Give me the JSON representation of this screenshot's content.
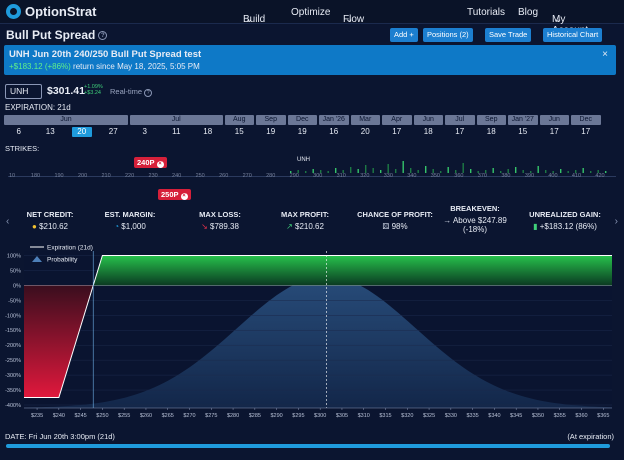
{
  "nav": {
    "logo": "OptionStrat",
    "items": [
      {
        "label": "Build",
        "caret": true
      },
      {
        "label": "Optimize",
        "caret": false
      },
      {
        "label": "Flow",
        "caret": true
      },
      {
        "label": "Tutorials",
        "caret": false
      },
      {
        "label": "Blog",
        "caret": false
      },
      {
        "label": "My Account",
        "caret": true
      }
    ]
  },
  "strategy": {
    "title": "Bull Put Spread"
  },
  "toolbar": {
    "add_label": "Add +",
    "positions_label": "Positions (2)",
    "save_label": "Save Trade",
    "historical_label": "Historical Chart"
  },
  "banner": {
    "title": "UNH Jun 20th 240/250 Bull Put Spread test",
    "gain": "+$183.12 (+86%)",
    "since": " return since May 18, 2025, 5:05 PM",
    "close": "×"
  },
  "quote": {
    "symbol": "UNH",
    "price": "$301.41",
    "change_pct": "+1.09%",
    "change_abs": "+$3.24",
    "realtime": "Real-time"
  },
  "expiration": {
    "label": "EXPIRATION: 21d",
    "months": [
      {
        "label": "Jun",
        "days": [
          "6",
          "13",
          "20",
          "27"
        ]
      },
      {
        "label": "Jul",
        "days": [
          "3",
          "11",
          "18"
        ]
      },
      {
        "label": "Aug",
        "days": [
          "15"
        ]
      },
      {
        "label": "Sep",
        "days": [
          "19"
        ]
      },
      {
        "label": "Dec",
        "days": [
          "19"
        ]
      },
      {
        "label": "Jan '26",
        "days": [
          "16"
        ]
      },
      {
        "label": "Mar",
        "days": [
          "20"
        ]
      },
      {
        "label": "Apr",
        "days": [
          "17"
        ]
      },
      {
        "label": "Jun",
        "days": [
          "18"
        ]
      },
      {
        "label": "Jul",
        "days": [
          "17"
        ]
      },
      {
        "label": "Sep",
        "days": [
          "18"
        ]
      },
      {
        "label": "Jan '27",
        "days": [
          "15"
        ]
      },
      {
        "label": "Jun",
        "days": [
          "17"
        ]
      },
      {
        "label": "Dec",
        "days": [
          "17"
        ]
      }
    ],
    "selected_day": "20"
  },
  "strikes": {
    "label": "STRIKES:",
    "ticks": [
      "10",
      "180",
      "190",
      "200",
      "210",
      "220",
      "230",
      "240",
      "250",
      "260",
      "270",
      "280",
      "290",
      "300",
      "310",
      "320",
      "330",
      "340",
      "350",
      "360",
      "370",
      "380",
      "390",
      "400",
      "410",
      "420"
    ],
    "legs": [
      {
        "label": "240P",
        "row": "top"
      },
      {
        "label": "250P",
        "row": "bottom"
      }
    ],
    "underlying_label": "UNH"
  },
  "stats": [
    {
      "label": "NET CREDIT:",
      "value": "$210.62",
      "icon": "coin-icon"
    },
    {
      "label": "EST. MARGIN:",
      "value": "$1,000",
      "icon": "pie-icon"
    },
    {
      "label": "MAX LOSS:",
      "value": "$789.38",
      "icon": "down-arrow-icon"
    },
    {
      "label": "MAX PROFIT:",
      "value": "$210.62",
      "icon": "up-arrow-icon"
    },
    {
      "label": "CHANCE OF PROFIT:",
      "value": "98%",
      "icon": "dice-icon"
    },
    {
      "label": "BREAKEVEN:",
      "value": "Above $247.89",
      "value2": "(-18%)",
      "icon": "right-arrow-icon"
    },
    {
      "label": "UNREALIZED GAIN:",
      "value": "+$183.12 (86%)",
      "icon": "money-icon"
    }
  ],
  "chart_data": {
    "type": "area",
    "legend": [
      {
        "name": "Expiration (21d)"
      },
      {
        "name": "Probability"
      }
    ],
    "x_ticks": [
      "$235",
      "$240",
      "$245",
      "$250",
      "$255",
      "$260",
      "$265",
      "$270",
      "$275",
      "$280",
      "$285",
      "$290",
      "$295",
      "$300",
      "$305",
      "$310",
      "$315",
      "$320",
      "$325",
      "$330",
      "$335",
      "$340",
      "$345",
      "$350",
      "$355",
      "$360",
      "$365"
    ],
    "y_ticks": [
      "100%",
      "50%",
      "0%",
      "-50%",
      "-100%",
      "-150%",
      "-200%",
      "-250%",
      "-300%",
      "-350%",
      "-400%"
    ],
    "xlim": [
      232,
      367
    ],
    "ylim": [
      -410,
      115
    ],
    "payoff": {
      "x": [
        232,
        240,
        250,
        367
      ],
      "y": [
        -375,
        -375,
        100,
        100
      ]
    },
    "breakeven": 247.89,
    "current_price": 301.41,
    "probability": {
      "mean": 301.41,
      "sd": 20.5
    }
  },
  "footer": {
    "date_label": "DATE: Fri Jun 20th 3:00pm (21d)",
    "at_exp": "(At expiration)"
  }
}
